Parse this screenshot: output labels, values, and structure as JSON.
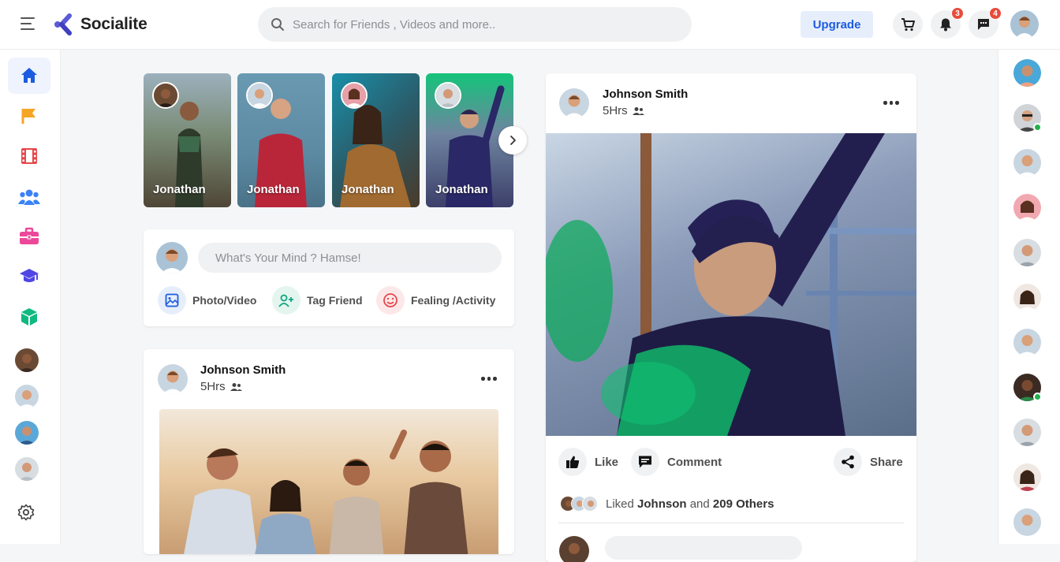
{
  "app": {
    "name": "Socialite"
  },
  "colors": {
    "brand_blue": "#1c5ce0",
    "brand_purple": "#5b5bd6",
    "badge_red": "#e74c3c",
    "online_green": "#22b14c"
  },
  "header": {
    "search_placeholder": "Search for Friends , Videos and more..",
    "upgrade_label": "Upgrade",
    "icons": [
      "menu-icon",
      "search-icon",
      "cart-icon",
      "bell-icon",
      "chat-icon"
    ],
    "notifications_count": "3",
    "messages_count": "4"
  },
  "sidebar": {
    "items": [
      {
        "name": "home-icon",
        "color": "#1c5ce0",
        "active": true
      },
      {
        "name": "flag-icon",
        "color": "#f5a524"
      },
      {
        "name": "film-icon",
        "color": "#e5484d"
      },
      {
        "name": "group-icon",
        "color": "#3b82f6"
      },
      {
        "name": "briefcase-icon",
        "color": "#ec4899"
      },
      {
        "name": "graduation-cap-icon",
        "color": "#4f46e5"
      },
      {
        "name": "cube-icon",
        "color": "#10b981"
      }
    ],
    "settings_icon": "gear-icon"
  },
  "stories": [
    {
      "name": "Jonathan"
    },
    {
      "name": "Jonathan"
    },
    {
      "name": "Jonathan"
    },
    {
      "name": "Jonathan"
    }
  ],
  "composer": {
    "placeholder": "What's Your Mind ? Hamse!",
    "actions": [
      {
        "label": "Photo/Video",
        "icon": "image-icon",
        "color": "#1c5ce0"
      },
      {
        "label": "Tag Friend",
        "icon": "user-plus-icon",
        "color": "#10a37f"
      },
      {
        "label": "Fealing /Activity",
        "icon": "smile-icon",
        "color": "#e5484d"
      }
    ]
  },
  "post1": {
    "author": "Johnson Smith",
    "time": "5Hrs"
  },
  "post2": {
    "author": "Johnson Smith",
    "time": "5Hrs",
    "like_label": "Like",
    "comment_label": "Comment",
    "share_label": "Share",
    "liked_prefix": "Liked",
    "liked_name": "Johnson",
    "liked_and": "and",
    "liked_others": "209 Others"
  },
  "contacts": [
    {
      "online": false
    },
    {
      "online": true
    },
    {
      "online": false
    },
    {
      "online": false
    },
    {
      "online": false
    },
    {
      "online": false
    },
    {
      "online": false
    },
    {
      "online": true
    },
    {
      "online": false
    },
    {
      "online": false
    }
  ]
}
